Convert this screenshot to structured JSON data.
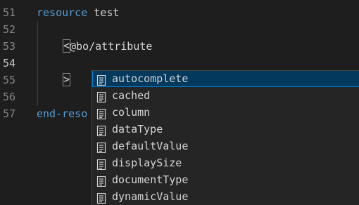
{
  "editor": {
    "line_numbers": [
      "51",
      "52",
      "53",
      "54",
      "55",
      "56",
      "57"
    ],
    "lines": {
      "l51_keyword": "resource",
      "l51_name": " test",
      "l53_open": "<",
      "l53_text": "@bo/attribute",
      "l55_close": ">",
      "l57_text": "end-reso"
    }
  },
  "suggestions": {
    "selected_index": 0,
    "icon": "property-icon",
    "items": [
      "autocomplete",
      "cached",
      "column",
      "dataType",
      "defaultValue",
      "displaySize",
      "documentType",
      "dynamicValue"
    ]
  },
  "colors": {
    "background": "#1e1e1e",
    "keyword": "#569cd6",
    "selection": "#04395e",
    "selection_border": "#007fd4"
  }
}
